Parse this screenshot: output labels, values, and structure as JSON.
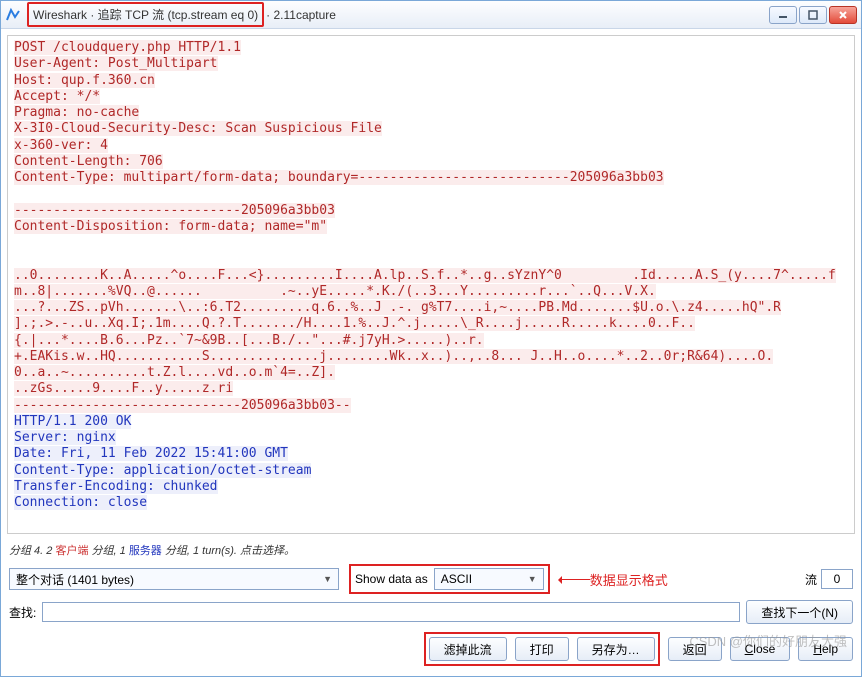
{
  "window": {
    "app_prefix": "Wireshark · 追踪 TCP 流 (tcp.stream eq 0)",
    "file_suffix": " · 2.11capture"
  },
  "stream": {
    "request": "POST /cloudquery.php HTTP/1.1\nUser-Agent: Post_Multipart\nHost: qup.f.360.cn\nAccept: */*\nPragma: no-cache\nX-3I0-Cloud-Security-Desc: Scan Suspicious File\nx-360-ver: 4\nContent-Length: 706\nContent-Type: multipart/form-data; boundary=---------------------------205096a3bb03\n\n-----------------------------205096a3bb03\nContent-Disposition: form-data; name=\"m\"\n\n\n..0........K..A.....^o....F...<}.........I....A.lp..S.f..*..g..sYznY^0         .Id.....A.S_(y....7^.....fm..8|.......%VQ..@......          .~..yE.....*.K./(..3...Y.........r...`..Q...V.X.\n...?...ZS..pVh.......\\..:6.T2.........q.6..%..J .-. g%T7....i,~....PB.Md.......$U.o.\\.z4.....hQ\".R\n].;.>.-..u..Xq.I;.1m....Q.?.T......./H....1.%..J.^.j.....\\_R....j.....R.....k....0..F..\n{.|...*....B.6...Pz..`7~&9B..[...B./..\"...#.j7yH.>.....)..r.\n+.EAKis.w..HQ...........S..............j........Wk..x..)..,..8... J..H..o....*..2..0r;R&64)....O.\n0..a..~..........t.Z.l....vd..o.m`4=..Z].\n..zGs.....9....F..y.....z.ri\n-----------------------------205096a3bb03--",
    "response": "HTTP/1.1 200 OK\nServer: nginx\nDate: Fri, 11 Feb 2022 15:41:00 GMT\nContent-Type: application/octet-stream\nTransfer-Encoding: chunked\nConnection: close"
  },
  "info": {
    "prefix": "分组 4. 2 ",
    "client": "客户端",
    "mid1": " 分组, 1 ",
    "server": "服务器",
    "suffix": " 分组, 1 turn(s). 点击选择。"
  },
  "controls": {
    "conversation": "整个对话 (1401 bytes)",
    "show_as_label": "Show data as",
    "ascii": "ASCII",
    "annotation": "数据显示格式",
    "stream_label": "流",
    "stream_value": "0"
  },
  "search": {
    "label": "查找:",
    "value": "",
    "find_next": "查找下一个(N)"
  },
  "buttons": {
    "filter_out": "滤掉此流",
    "print": "打印",
    "save_as": "另存为…",
    "back": "返回",
    "close": "Close",
    "help": "Help"
  },
  "watermark": "CSDN @你们的好朋友大强"
}
